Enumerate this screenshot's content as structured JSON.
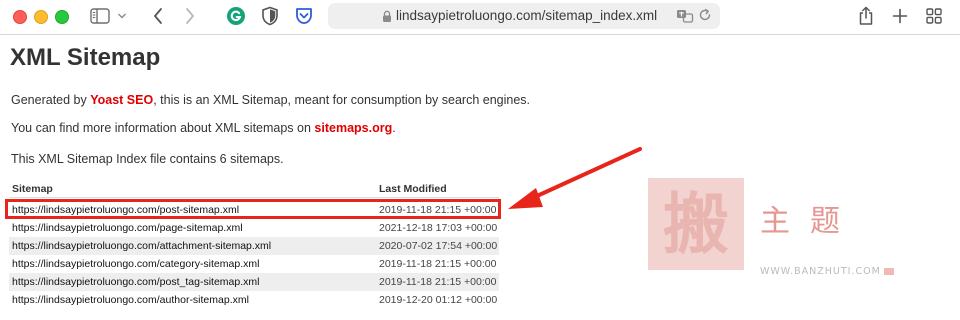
{
  "browser": {
    "url": "lindsaypietroluongo.com/sitemap_index.xml"
  },
  "page": {
    "title": "XML Sitemap",
    "generated_prefix": "Generated by ",
    "generated_link": "Yoast SEO",
    "generated_suffix": ", this is an XML Sitemap, meant for consumption by search engines.",
    "info_prefix": "You can find more information about XML sitemaps on ",
    "info_link": "sitemaps.org",
    "info_suffix": ".",
    "index_text": "This XML Sitemap Index file contains 6 sitemaps."
  },
  "table": {
    "headers": {
      "sitemap": "Sitemap",
      "last_modified": "Last Modified"
    },
    "rows": [
      {
        "url": "https://lindsaypietroluongo.com/post-sitemap.xml",
        "modified": "2019-11-18 21:15 +00:00"
      },
      {
        "url": "https://lindsaypietroluongo.com/page-sitemap.xml",
        "modified": "2021-12-18 17:03 +00:00"
      },
      {
        "url": "https://lindsaypietroluongo.com/attachment-sitemap.xml",
        "modified": "2020-07-02 17:54 +00:00"
      },
      {
        "url": "https://lindsaypietroluongo.com/category-sitemap.xml",
        "modified": "2019-11-18 21:15 +00:00"
      },
      {
        "url": "https://lindsaypietroluongo.com/post_tag-sitemap.xml",
        "modified": "2019-11-18 21:15 +00:00"
      },
      {
        "url": "https://lindsaypietroluongo.com/author-sitemap.xml",
        "modified": "2019-12-20 01:12 +00:00"
      }
    ]
  },
  "watermark": {
    "glyph": "搬",
    "chars": "主题",
    "url": "WWW.BANZHUTI.COM"
  },
  "colors": {
    "link_red": "#e00000",
    "highlight_red": "#e8251b"
  }
}
